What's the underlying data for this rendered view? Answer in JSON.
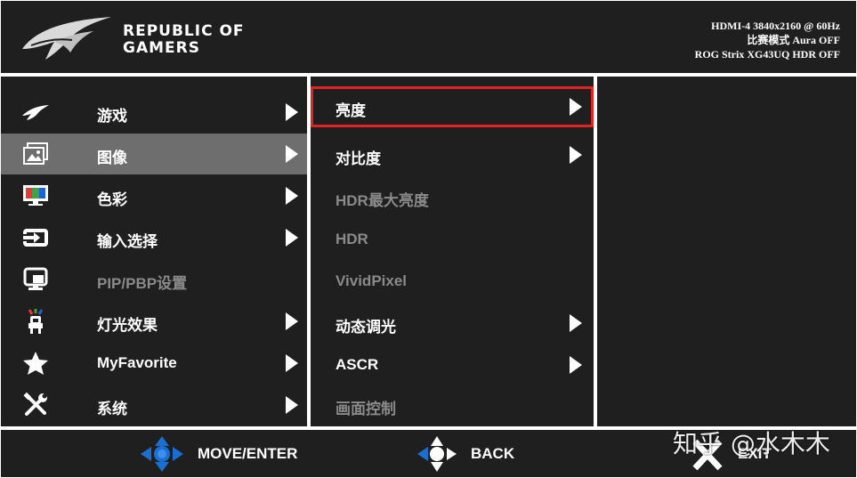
{
  "header": {
    "brand_line1": "REPUBLIC OF",
    "brand_line2": "GAMERS",
    "status_line1": "HDMI-4 3840x2160 @ 60Hz",
    "status_line2": "比赛模式 Aura OFF",
    "status_line3": "ROG Strix XG43UQ HDR OFF"
  },
  "main_menu": [
    {
      "label": "游戏",
      "icon": "rog-eye-icon",
      "enabled": true
    },
    {
      "label": "图像",
      "icon": "image-icon",
      "enabled": true,
      "selected": true
    },
    {
      "label": "色彩",
      "icon": "color-monitor-icon",
      "enabled": true
    },
    {
      "label": "输入选择",
      "icon": "input-select-icon",
      "enabled": true
    },
    {
      "label": "PIP/PBP设置",
      "icon": "pip-pbp-icon",
      "enabled": false
    },
    {
      "label": "灯光效果",
      "icon": "light-effect-icon",
      "enabled": true
    },
    {
      "label": "MyFavorite",
      "icon": "star-icon",
      "enabled": true
    },
    {
      "label": "系统",
      "icon": "tools-icon",
      "enabled": true
    }
  ],
  "sub_menu": [
    {
      "label": "亮度",
      "enabled": true,
      "highlighted": true
    },
    {
      "label": "对比度",
      "enabled": true
    },
    {
      "label": "HDR最大亮度",
      "enabled": false
    },
    {
      "label": "HDR",
      "enabled": false
    },
    {
      "label": "VividPixel",
      "enabled": false
    },
    {
      "label": "动态调光",
      "enabled": true
    },
    {
      "label": "ASCR",
      "enabled": true
    },
    {
      "label": "画面控制",
      "enabled": false
    }
  ],
  "footer": {
    "move_label": "MOVE/ENTER",
    "back_label": "BACK",
    "exit_label": "EXIT"
  },
  "watermark": "知乎 @水木木",
  "colors": {
    "panel_bg": "#1f1f1f",
    "selected_bg": "#6e6e6e",
    "highlight_border": "#e0231f",
    "disabled_text": "#8a8a8a",
    "joystick_blue": "#1a6fd1"
  }
}
